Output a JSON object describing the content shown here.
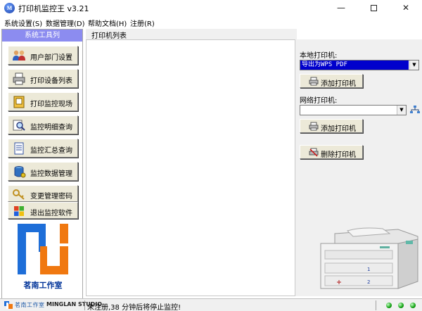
{
  "window": {
    "title": "打印机监控王 v3.21",
    "icon_letter": "M",
    "min_glyph": "—",
    "close_glyph": "✕"
  },
  "menu": [
    "系统设置(S)",
    "数据管理(D)",
    "帮助文档(H)",
    "注册(R)"
  ],
  "sidebar": {
    "header": "系统工具列",
    "buttons": [
      {
        "label": "用户部门设置",
        "icon": "users-icon"
      },
      {
        "label": "打印设备列表",
        "icon": "printer-icon"
      },
      {
        "label": "打印监控现场",
        "icon": "monitor-book-icon"
      },
      {
        "label": "监控明细查询",
        "icon": "search-icon"
      },
      {
        "label": "监控汇总查询",
        "icon": "report-icon"
      },
      {
        "label": "监控数据管理",
        "icon": "database-icon"
      },
      {
        "label": "变更管理密码",
        "icon": "key-icon"
      },
      {
        "label": "退出监控软件",
        "icon": "windows-logo-icon"
      }
    ],
    "logo_text": "茗南工作室"
  },
  "center": {
    "tab_label": "打印机列表"
  },
  "right_panel": {
    "local_label": "本地打印机:",
    "local_selected": "导出为WPS PDF",
    "add_local_label": "添加打印机",
    "network_label": "网络打印机:",
    "network_selected": "",
    "add_network_label": "添加打印机",
    "delete_label": "删除打印机"
  },
  "statusbar": {
    "brand_cn": "茗南工作室",
    "brand_en": "MINGLAN STUDIO",
    "message": "未注册,38 分钟后将停止监控!",
    "indicator_count": 3
  },
  "colors": {
    "sidebar_header": "#8c8cf0",
    "selection": "#0000cc",
    "logo_blue": "#1e6ed8",
    "logo_orange": "#f07810",
    "logo_text": "#003399",
    "status_led": "#10a010"
  }
}
